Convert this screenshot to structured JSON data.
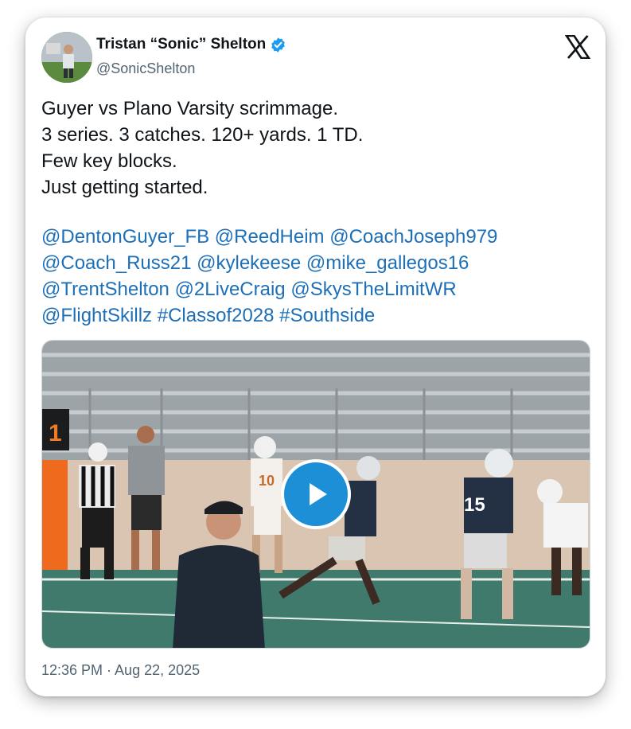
{
  "author": {
    "display_name": "Tristan “Sonic” Shelton",
    "handle": "@SonicShelton",
    "verified": true,
    "verified_color": "#1d9bf0"
  },
  "tweet": {
    "lines": [
      "Guyer vs Plano Varsity scrimmage.",
      "3 series. 3 catches. 120+ yards. 1 TD.",
      "Few key blocks.",
      "Just getting started."
    ],
    "mention_lines": [
      [
        "@DentonGuyer_FB",
        "@ReedHeim",
        "@CoachJoseph979"
      ],
      [
        "@Coach_Russ21",
        "@kylekeese",
        "@mike_gallegos16"
      ],
      [
        "@TrentShelton",
        "@2LiveCraig",
        "@SkysTheLimitWR"
      ],
      [
        "@FlightSkillz",
        "#Classof2028",
        "#Southside"
      ]
    ],
    "link_color": "#1d6fb8"
  },
  "media": {
    "type": "video",
    "jersey_numbers": [
      "10",
      "15"
    ],
    "scoreboard_digit": "1",
    "play_button_color": "#1d8fd6"
  },
  "footer": {
    "timestamp": "12:36 PM · Aug 22, 2025"
  },
  "icons": {
    "brand": "x-logo-icon",
    "verified": "verified-badge-icon",
    "play": "play-icon"
  }
}
